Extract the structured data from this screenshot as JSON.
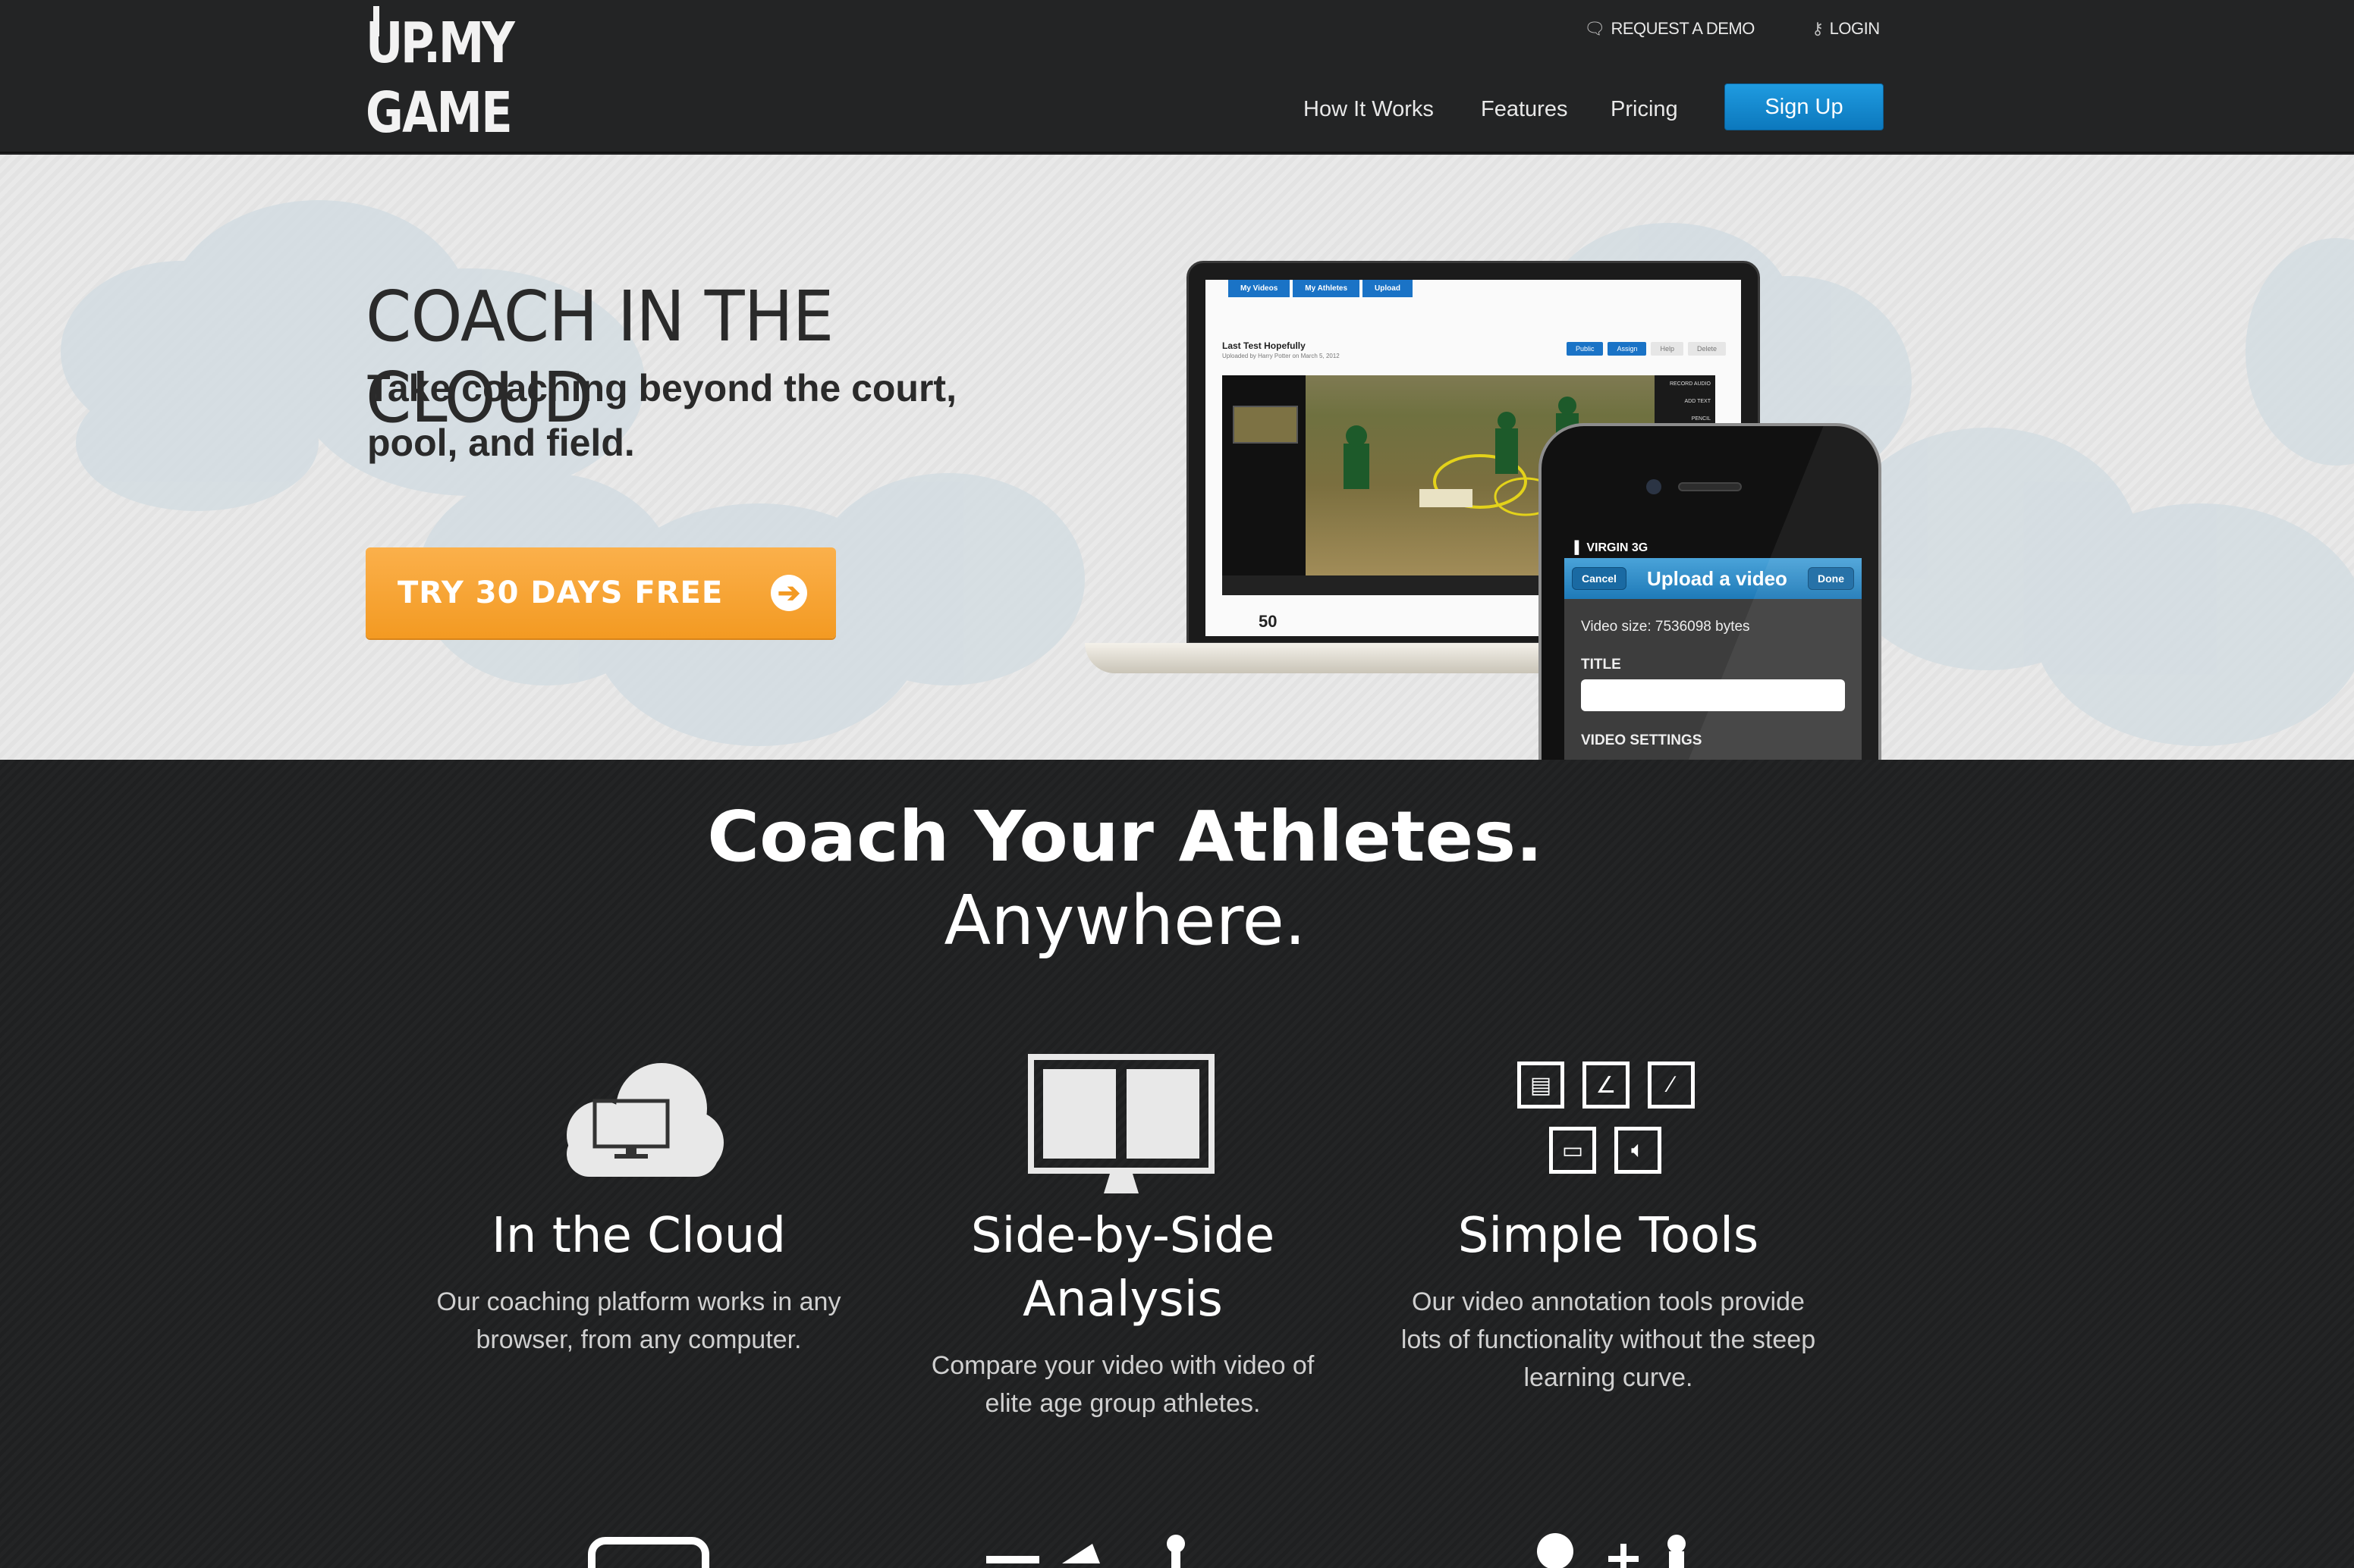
{
  "header": {
    "logo_top": "UP.MY",
    "logo_bottom": "GAME",
    "utility": {
      "demo_label": "REQUEST A DEMO",
      "login_label": "LOGIN"
    },
    "nav": {
      "how": "How It Works",
      "features": "Features",
      "pricing": "Pricing",
      "signup": "Sign Up"
    }
  },
  "hero": {
    "title": "COACH IN THE CLOUD",
    "subtitle_line1": "Take coaching beyond the court,",
    "subtitle_line2": "pool, and field.",
    "cta_label": "TRY 30 DAYS FREE",
    "laptop_app": {
      "tabs": [
        "My Videos",
        "My Athletes",
        "Upload"
      ],
      "video_title": "Last Test Hopefully",
      "video_sub": "Uploaded by Harry Potter on March 5, 2012",
      "actions": [
        "Public",
        "Assign",
        "Help",
        "Delete"
      ],
      "tools": [
        "RECORD AUDIO",
        "ADD TEXT",
        "PENCIL"
      ],
      "views": "50"
    },
    "phone_app": {
      "carrier": "VIRGIN 3G",
      "cancel": "Cancel",
      "title": "Upload a video",
      "done": "Done",
      "size_text": "Video size: 7536098 bytes",
      "title_label": "TITLE",
      "settings_label": "VIDEO SETTINGS"
    }
  },
  "features": {
    "title": "Coach Your Athletes.",
    "subtitle": "Anywhere.",
    "columns": [
      {
        "heading": "In the Cloud",
        "text_line1": "Our coaching platform works in any",
        "text_line2": "browser, from any computer."
      },
      {
        "heading_line1": "Side-by-Side",
        "heading_line2": "Analysis",
        "text_line1": "Compare your video with video of",
        "text_line2": "elite age group athletes."
      },
      {
        "heading": "Simple Tools",
        "text_line1": "Our video annotation tools provide",
        "text_line2": "lots of functionality without the steep",
        "text_line3": "learning curve."
      }
    ]
  },
  "colors": {
    "header_bg": "#232425",
    "accent_blue": "#1585d0",
    "cta_orange": "#f7a132",
    "hero_bg": "#e7e7e7"
  }
}
